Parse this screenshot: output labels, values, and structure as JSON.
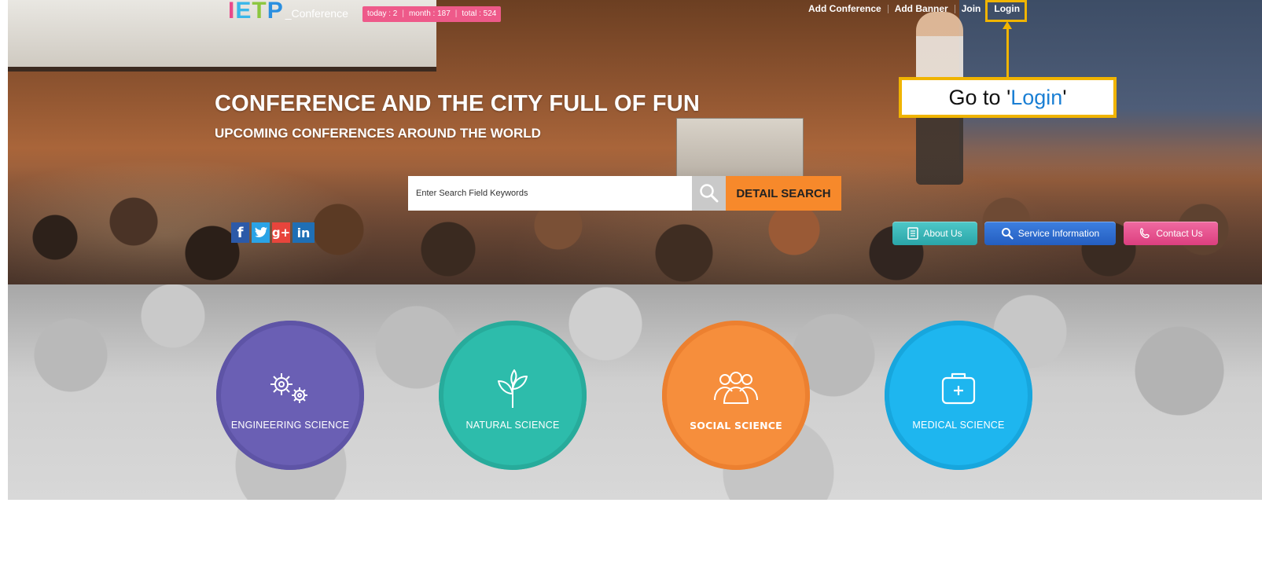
{
  "header": {
    "logo": {
      "letters": [
        "I",
        "E",
        "T",
        "P"
      ],
      "suffix": "_Conference"
    },
    "stats": {
      "today": "today : 2",
      "month": "month : 187",
      "total": "total : 524"
    },
    "nav": [
      {
        "label": "Add Conference"
      },
      {
        "label": "Add Banner"
      },
      {
        "label": "Join"
      },
      {
        "label": "Login"
      }
    ]
  },
  "callout": {
    "prefix": "Go to '",
    "highlight": "Login",
    "suffix": "'"
  },
  "hero": {
    "headline": "CONFERENCE AND THE CITY FULL OF FUN",
    "subheadline": "UPCOMING CONFERENCES AROUND THE WORLD"
  },
  "search": {
    "placeholder": "Enter Search Field Keywords",
    "button_icon": "search-icon",
    "detail_label": "DETAIL SEARCH"
  },
  "social": [
    {
      "name": "facebook",
      "glyph": "f"
    },
    {
      "name": "twitter",
      "glyph": "t"
    },
    {
      "name": "google-plus",
      "glyph": "g+"
    },
    {
      "name": "linkedin",
      "glyph": "in"
    }
  ],
  "quick_buttons": [
    {
      "label": "About Us",
      "icon": "document-icon",
      "color": "#2aa5a8"
    },
    {
      "label": "Service Information",
      "icon": "magnifier-icon",
      "color": "#245ec0"
    },
    {
      "label": "Contact Us",
      "icon": "phone-icon",
      "color": "#dc3f7f"
    }
  ],
  "categories": [
    {
      "label": "ENGINEERING SCIENCE",
      "icon": "gears-icon",
      "color": "#6a5fb4"
    },
    {
      "label": "NATURAL SCIENCE",
      "icon": "sprout-icon",
      "color": "#2dbcab"
    },
    {
      "label": "SOCIAL SCIENCE",
      "icon": "people-icon",
      "color": "#f68e3c"
    },
    {
      "label": "MEDICAL SCIENCE",
      "icon": "medical-kit-icon",
      "color": "#1eb6ef"
    }
  ],
  "colors": {
    "callout_border": "#f0b400",
    "stats_bg": "#ee5a8a",
    "detail_search_bg": "#f7892b"
  }
}
